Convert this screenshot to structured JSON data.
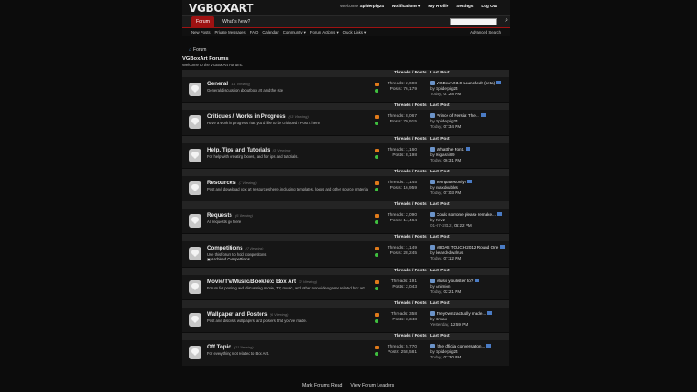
{
  "app": {
    "logo": "VGBOXART"
  },
  "top_links": {
    "welcome_label": "Welcome,",
    "username": "Spiderpig24",
    "notifications": "Notifications ▾",
    "my_profile": "My Profile",
    "settings": "Settings",
    "logout": "Log Out"
  },
  "nav": {
    "forum_tab": "Forum",
    "whats_new": "What's New?",
    "search_placeholder": ""
  },
  "subnav": {
    "new_posts": "New Posts",
    "private_messages": "Private Messages",
    "faq": "FAQ",
    "calendar": "Calendar",
    "community": "Community ▾",
    "forum_actions": "Forum Actions ▾",
    "quick_links": "Quick Links ▾",
    "advanced_search": "Advanced Search"
  },
  "breadcrumb": {
    "item": "Forum"
  },
  "page": {
    "title": "VGBoxArt Forums",
    "welcome": "Welcome to the VGBoxArt Forums."
  },
  "columns": {
    "threads_posts": "Threads / Posts",
    "last_post": "Last Post"
  },
  "forums": [
    {
      "name": "General",
      "viewing": "(11 Viewing)",
      "desc": "General discussion about box art and the site",
      "threads": "Threads: 2,698",
      "posts": "Posts: 76,179",
      "last_title": "VGBoxArt 3.0 Launched! (beta)",
      "by": "by",
      "user": "Spiderpig24",
      "date": "Today,",
      "time": "07:28 PM"
    },
    {
      "name": "Critiques / Works in Progress",
      "viewing": "(13 Viewing)",
      "desc": "Have a work in progress that you'd like to be critiqued? Post it here!",
      "threads": "Threads: 8,067",
      "posts": "Posts: 70,915",
      "last_title": "Prince of Persia: The...",
      "by": "by",
      "user": "Spiderpig24",
      "date": "Today,",
      "time": "07:34 PM"
    },
    {
      "name": "Help, Tips and Tutorials",
      "viewing": "(3 Viewing)",
      "desc": "For help with creating boxes, and for tips and tutorials.",
      "threads": "Threads: 1,160",
      "posts": "Posts: 8,198",
      "last_title": "What the Font.",
      "by": "by",
      "user": "Higashi89",
      "date": "Today,",
      "time": "06:31 PM"
    },
    {
      "name": "Resources",
      "viewing": "(7 Viewing)",
      "desc": "Post and download box art resources here, including templates, logos and other source material",
      "threads": "Threads: 1,145",
      "posts": "Posts: 16,959",
      "last_title": "Templates only!",
      "by": "by",
      "user": "maxdoubles",
      "date": "Today,",
      "time": "07:03 PM"
    },
    {
      "name": "Requests",
      "viewing": "(6 Viewing)",
      "desc": "All requests go here",
      "threads": "Threads: 2,090",
      "posts": "Posts: 14,464",
      "last_title": "Could somone please remake...",
      "by": "by",
      "user": "trevz",
      "date": "01-07-2012,",
      "time": "06:22 PM"
    },
    {
      "name": "Competitions",
      "viewing": "(7 Viewing)",
      "desc": "Use this forum to hold competitions",
      "extra": "Archived Competitions",
      "threads": "Threads: 1,149",
      "posts": "Posts: 28,245",
      "last_title": "MIDAS TOUCH 2012 Round One",
      "by": "by",
      "user": "beardedwalrus",
      "date": "Today,",
      "time": "07:12 PM"
    },
    {
      "name": "Movie/TV/Music/Book/etc Box Art",
      "viewing": "(2 Viewing)",
      "desc": "Forum for posting and discussing movie, TV, music, and other non-video game related box art.",
      "threads": "Threads: 191",
      "posts": "Posts: 2,043",
      "last_title": "Music you listen to?",
      "by": "by",
      "user": "Animion",
      "date": "Today,",
      "time": "02:21 PM"
    },
    {
      "name": "Wallpaper and Posters",
      "viewing": "(6 Viewing)",
      "desc": "Post and discuss wallpapers and posters that you've made.",
      "threads": "Threads: 358",
      "posts": "Posts: 3,348",
      "last_title": "TreyOwnz actually made...",
      "by": "by",
      "user": "Xmax",
      "date": "Yesterday,",
      "time": "12:59 PM"
    },
    {
      "name": "Off Topic",
      "viewing": "(11 Viewing)",
      "desc": "For everything not related to Box Art.",
      "threads": "Threads: 5,770",
      "posts": "Posts: 258,581",
      "last_title": "(the official conversation...",
      "by": "by",
      "user": "Spiderpig24",
      "date": "Today,",
      "time": "07:30 PM"
    }
  ],
  "footer": {
    "mark_read": "Mark Forums Read",
    "view_leaders": "View Forum Leaders"
  }
}
